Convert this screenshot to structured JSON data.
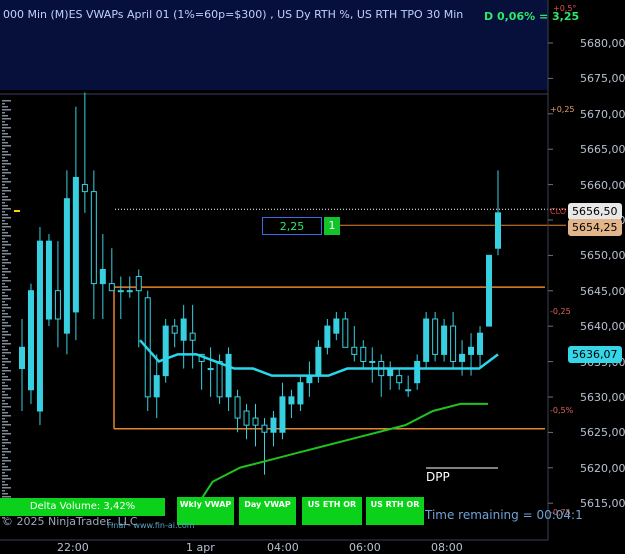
{
  "header": {
    "title": "000 Min (M)ES VWAPs April 01 (1%=60p=$300) , US Dy RTH %, US RTH TPO 30 Min",
    "d_readout": "D 0,06% = 3,25"
  },
  "price_axis": {
    "ticks": [
      "5680,00",
      "5675,00",
      "5670,00",
      "5665,00",
      "5660,00",
      "5655,00",
      "5650,00",
      "5645,00",
      "5640,00",
      "5635,00",
      "5630,00",
      "5625,00",
      "5620,00",
      "5615,00"
    ]
  },
  "price_tags": {
    "last": "5656,50",
    "position": "5654,25",
    "vwap": "5636,07"
  },
  "pct_labels": {
    "top": "+0,5°",
    "plus025": "+0,25",
    "close": "CLO",
    "minus025": "-0,25",
    "minus05": "-0,5%",
    "minus075": "-0,75"
  },
  "time_axis": {
    "labels": [
      "22:00",
      "1 apr",
      "04:00",
      "06:00",
      "08:00"
    ]
  },
  "trade": {
    "price": "2,25",
    "qty": "1"
  },
  "dpp_label": "DPP",
  "delta_volume": "Delta Volume: 3,42%",
  "buttons": {
    "wkly_vwap": "Wkly VWAP",
    "day_vwap": "Day VWAP",
    "us_eth_or": "US ETH OR",
    "us_rth_or": "US RTH OR"
  },
  "footer": {
    "copyright": "2025 NinjaTrader, LLC",
    "finai": "Finai - www.fin-ai.com",
    "time_remaining": "Time remaining = 00:04:1"
  },
  "chart_data": {
    "type": "candlestick",
    "ylim": [
      5612,
      5683
    ],
    "x_ticks": [
      "22:00",
      "1 apr",
      "04:00",
      "06:00",
      "08:00"
    ],
    "candles": [
      {
        "o": 5634,
        "h": 5641,
        "l": 5628,
        "c": 5637
      },
      {
        "o": 5631,
        "h": 5646,
        "l": 5629,
        "c": 5645
      },
      {
        "o": 5628,
        "h": 5654,
        "l": 5626,
        "c": 5652
      },
      {
        "o": 5641,
        "h": 5653,
        "l": 5640,
        "c": 5652
      },
      {
        "o": 5645,
        "h": 5652,
        "l": 5637,
        "c": 5641
      },
      {
        "o": 5639,
        "h": 5662,
        "l": 5636,
        "c": 5658
      },
      {
        "o": 5642,
        "h": 5671,
        "l": 5638,
        "c": 5661
      },
      {
        "o": 5660,
        "h": 5673,
        "l": 5656,
        "c": 5659
      },
      {
        "o": 5659,
        "h": 5662,
        "l": 5641,
        "c": 5646
      },
      {
        "o": 5646,
        "h": 5653,
        "l": 5641,
        "c": 5648
      },
      {
        "o": 5646,
        "h": 5651,
        "l": 5645,
        "c": 5645
      },
      {
        "o": 5645,
        "h": 5647,
        "l": 5641,
        "c": 5645
      },
      {
        "o": 5645,
        "h": 5647,
        "l": 5644,
        "c": 5645
      },
      {
        "o": 5647,
        "h": 5648,
        "l": 5637,
        "c": 5645
      },
      {
        "o": 5644,
        "h": 5645,
        "l": 5628,
        "c": 5630
      },
      {
        "o": 5630,
        "h": 5636,
        "l": 5627,
        "c": 5633
      },
      {
        "o": 5633,
        "h": 5641,
        "l": 5632,
        "c": 5640
      },
      {
        "o": 5640,
        "h": 5641,
        "l": 5637,
        "c": 5639
      },
      {
        "o": 5638,
        "h": 5643,
        "l": 5634,
        "c": 5641
      },
      {
        "o": 5639,
        "h": 5643,
        "l": 5634,
        "c": 5638
      },
      {
        "o": 5636,
        "h": 5636,
        "l": 5631,
        "c": 5635
      },
      {
        "o": 5634,
        "h": 5637,
        "l": 5630,
        "c": 5634
      },
      {
        "o": 5635,
        "h": 5636,
        "l": 5629,
        "c": 5630
      },
      {
        "o": 5630,
        "h": 5637,
        "l": 5628,
        "c": 5636
      },
      {
        "o": 5630,
        "h": 5631,
        "l": 5625,
        "c": 5627
      },
      {
        "o": 5628,
        "h": 5629,
        "l": 5624,
        "c": 5626
      },
      {
        "o": 5627,
        "h": 5629,
        "l": 5623,
        "c": 5626
      },
      {
        "o": 5626,
        "h": 5627,
        "l": 5619,
        "c": 5625
      },
      {
        "o": 5625,
        "h": 5628,
        "l": 5623,
        "c": 5627
      },
      {
        "o": 5625,
        "h": 5632,
        "l": 5624,
        "c": 5630
      },
      {
        "o": 5629,
        "h": 5631,
        "l": 5627,
        "c": 5630
      },
      {
        "o": 5629,
        "h": 5633,
        "l": 5628,
        "c": 5632
      },
      {
        "o": 5632,
        "h": 5635,
        "l": 5630,
        "c": 5633
      },
      {
        "o": 5633,
        "h": 5638,
        "l": 5632,
        "c": 5637
      },
      {
        "o": 5637,
        "h": 5641,
        "l": 5636,
        "c": 5640
      },
      {
        "o": 5639,
        "h": 5642,
        "l": 5638,
        "c": 5641
      },
      {
        "o": 5641,
        "h": 5642,
        "l": 5637,
        "c": 5637
      },
      {
        "o": 5637,
        "h": 5640,
        "l": 5635,
        "c": 5636
      },
      {
        "o": 5637,
        "h": 5638,
        "l": 5634,
        "c": 5635
      },
      {
        "o": 5635,
        "h": 5637,
        "l": 5632,
        "c": 5635
      },
      {
        "o": 5635,
        "h": 5636,
        "l": 5630,
        "c": 5633
      },
      {
        "o": 5633,
        "h": 5635,
        "l": 5631,
        "c": 5634
      },
      {
        "o": 5633,
        "h": 5634,
        "l": 5631,
        "c": 5632
      },
      {
        "o": 5631,
        "h": 5633,
        "l": 5630,
        "c": 5631
      },
      {
        "o": 5632,
        "h": 5636,
        "l": 5631,
        "c": 5635
      },
      {
        "o": 5635,
        "h": 5642,
        "l": 5634,
        "c": 5641
      },
      {
        "o": 5641,
        "h": 5642,
        "l": 5635,
        "c": 5636
      },
      {
        "o": 5636,
        "h": 5641,
        "l": 5635,
        "c": 5640
      },
      {
        "o": 5640,
        "h": 5642,
        "l": 5634,
        "c": 5635
      },
      {
        "o": 5635,
        "h": 5638,
        "l": 5633,
        "c": 5636
      },
      {
        "o": 5636,
        "h": 5639,
        "l": 5633,
        "c": 5637
      },
      {
        "o": 5636,
        "h": 5640,
        "l": 5634,
        "c": 5639
      },
      {
        "o": 5640,
        "h": 5650,
        "l": 5640,
        "c": 5650
      },
      {
        "o": 5651,
        "h": 5662,
        "l": 5650,
        "c": 5656
      }
    ],
    "vwap_line": [
      5638,
      5635,
      5636,
      5636,
      5635,
      5634,
      5634,
      5633,
      5633,
      5633,
      5633,
      5634,
      5634,
      5634,
      5634,
      5634,
      5634,
      5634,
      5634,
      5636
    ],
    "weekly_vwap_line": [
      5612,
      5618,
      5620,
      5621,
      5622,
      5623,
      5624,
      5625,
      5626,
      5628,
      5629,
      5629
    ],
    "or_box": {
      "high": 5645.5,
      "low": 5625.5
    },
    "dotted_line_price": 5656.5,
    "position_line_price": 5654.25
  }
}
